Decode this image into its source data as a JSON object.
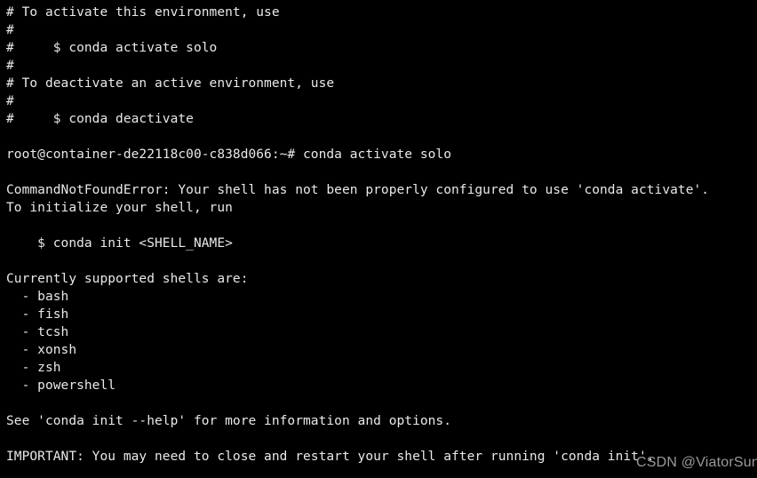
{
  "terminal": {
    "background_color": "#000000",
    "text_color": "#e9e9e9",
    "lines": [
      {
        "id": "comment-activate-intro",
        "text": "# To activate this environment, use"
      },
      {
        "id": "comment-blank-1",
        "text": "#"
      },
      {
        "id": "comment-activate-command",
        "text": "#     $ conda activate solo"
      },
      {
        "id": "comment-blank-2",
        "text": "#"
      },
      {
        "id": "comment-deactivate-intro",
        "text": "# To deactivate an active environment, use"
      },
      {
        "id": "comment-blank-3",
        "text": "#"
      },
      {
        "id": "comment-deactivate-command",
        "text": "#     $ conda deactivate"
      },
      {
        "id": "spacer-1",
        "text": ""
      },
      {
        "id": "prompt-line",
        "text": "root@container-de22118c00-c838d066:~# conda activate solo"
      },
      {
        "id": "spacer-2",
        "text": ""
      },
      {
        "id": "error-headline",
        "text": "CommandNotFoundError: Your shell has not been properly configured to use 'conda activate'."
      },
      {
        "id": "error-initialize-hint",
        "text": "To initialize your shell, run"
      },
      {
        "id": "spacer-3",
        "text": ""
      },
      {
        "id": "init-command",
        "text": "    $ conda init <SHELL_NAME>"
      },
      {
        "id": "spacer-4",
        "text": ""
      },
      {
        "id": "shells-heading",
        "text": "Currently supported shells are:"
      },
      {
        "id": "shell-bash",
        "text": "  - bash"
      },
      {
        "id": "shell-fish",
        "text": "  - fish"
      },
      {
        "id": "shell-tcsh",
        "text": "  - tcsh"
      },
      {
        "id": "shell-xonsh",
        "text": "  - xonsh"
      },
      {
        "id": "shell-zsh",
        "text": "  - zsh"
      },
      {
        "id": "shell-powershell",
        "text": "  - powershell"
      },
      {
        "id": "spacer-5",
        "text": ""
      },
      {
        "id": "see-help-line",
        "text": "See 'conda init --help' for more information and options."
      },
      {
        "id": "spacer-6",
        "text": ""
      },
      {
        "id": "important-line",
        "text": "IMPORTANT: You may need to close and restart your shell after running 'conda init'."
      }
    ]
  },
  "watermark": {
    "text": "CSDN @ViatorSun",
    "color": "#9a9a9a"
  }
}
